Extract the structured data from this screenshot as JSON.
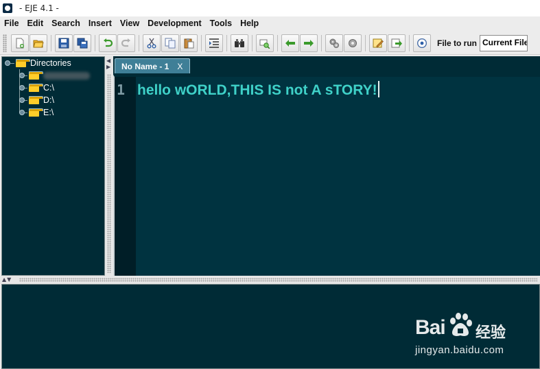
{
  "window": {
    "title": "- EJE 4.1 -"
  },
  "menu": [
    {
      "key": "file",
      "label": "File"
    },
    {
      "key": "edit",
      "label": "Edit"
    },
    {
      "key": "search",
      "label": "Search"
    },
    {
      "key": "insert",
      "label": "Insert"
    },
    {
      "key": "view",
      "label": "View"
    },
    {
      "key": "development",
      "label": "Development"
    },
    {
      "key": "tools",
      "label": "Tools"
    },
    {
      "key": "help",
      "label": "Help"
    }
  ],
  "toolbar": {
    "buttons": [
      "new-file-icon",
      "open-file-icon",
      "save-icon",
      "save-all-icon",
      "undo-icon",
      "redo-icon",
      "cut-icon",
      "copy-icon",
      "paste-icon",
      "indent-icon",
      "find-icon",
      "search-replace-icon",
      "back-arrow-icon",
      "forward-arrow-icon",
      "compile-gear-icon",
      "build-gear-icon",
      "edit-note-icon",
      "export-icon",
      "run-icon"
    ],
    "file_to_run_label": "File to run",
    "file_to_run_value": "Current File"
  },
  "tree": {
    "root_label": "Directories",
    "items": [
      {
        "label": ""
      },
      {
        "label": "C:\\"
      },
      {
        "label": "D:\\"
      },
      {
        "label": "E:\\"
      }
    ]
  },
  "editor": {
    "tab_label": "No Name - 1",
    "tab_close": "X",
    "line_number": "1",
    "code": "hello wORLD,THIS IS not A sTORY!"
  },
  "watermark": {
    "brand": "Bai",
    "brand_suffix": "经验",
    "url": "jingyan.baidu.com"
  },
  "colors": {
    "editor_bg": "#003340",
    "panel_bg": "#002b36",
    "code_text": "#3fd1c8",
    "tab_bg": "#3f7f97"
  }
}
